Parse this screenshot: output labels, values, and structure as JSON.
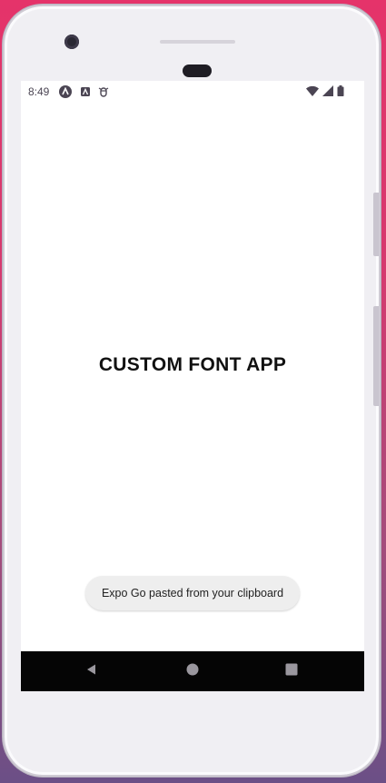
{
  "status_bar": {
    "time": "8:49",
    "left_icons": [
      "expo-a-icon",
      "app-a-icon",
      "debug-icon"
    ],
    "right_icons": [
      "wifi-icon",
      "cellular-signal-icon",
      "battery-icon"
    ]
  },
  "app": {
    "title": "CUSTOM FONT APP"
  },
  "toast": {
    "message": "Expo Go pasted from your clipboard"
  },
  "nav_bar": {
    "buttons": [
      "back-icon",
      "home-icon",
      "recents-icon"
    ]
  },
  "colors": {
    "background_top": "#e5336a",
    "background_bottom": "#6b4f86",
    "screen": "#ffffff",
    "nav_bar": "#050505",
    "toast": "#eeeeee"
  }
}
